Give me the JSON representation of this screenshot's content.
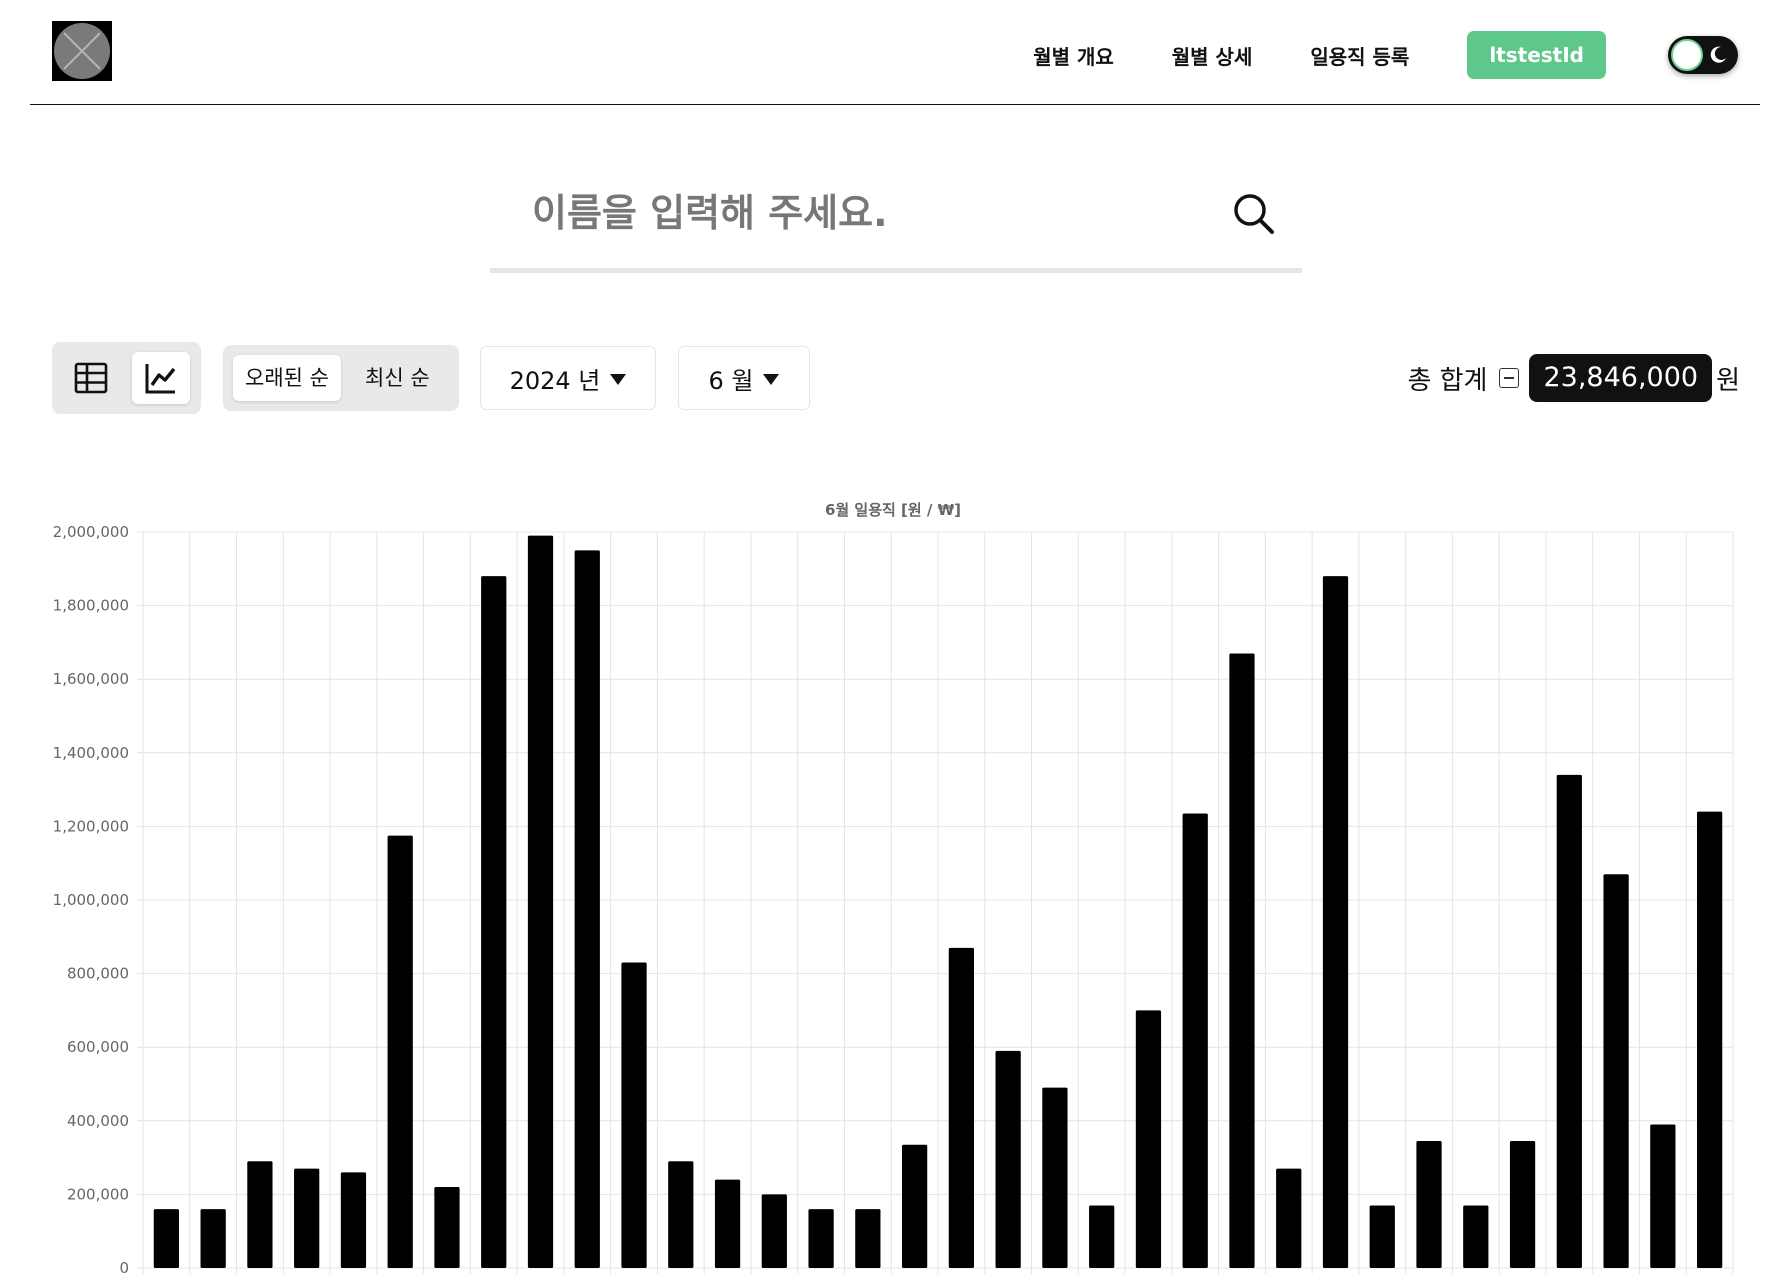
{
  "header": {
    "nav": [
      "월별 개요",
      "월별 상세",
      "일용직 등록"
    ],
    "user": "ltstestId"
  },
  "search": {
    "placeholder": "이름을 입력해 주세요."
  },
  "controls": {
    "view_active": "chart",
    "sort_options": [
      "오래된 순",
      "최신 순"
    ],
    "sort_active": "오래된 순",
    "year": "2024 년",
    "month": "6 월"
  },
  "total": {
    "label": "총 합계",
    "amount": "23,846,000",
    "unit": "원"
  },
  "colors": {
    "accent": "#5ec88a",
    "bar": "#000000",
    "grid": "#e4e4e4"
  },
  "chart_data": {
    "type": "bar",
    "title": "6월 일용직 [원 / ₩]",
    "xlabel": "",
    "ylabel": "",
    "ylim": [
      0,
      2000000
    ],
    "yticks": [
      0,
      200000,
      400000,
      600000,
      800000,
      1000000,
      1200000,
      1400000,
      1600000,
      1800000,
      2000000
    ],
    "ytick_labels": [
      "0",
      "200,000",
      "400,000",
      "600,000",
      "800,000",
      "1,000,000",
      "1,200,000",
      "1,400,000",
      "1,600,000",
      "1,800,000",
      "2,000,000"
    ],
    "grid": true,
    "legend": "none",
    "values": [
      160000,
      160000,
      290000,
      270000,
      260000,
      1175000,
      220000,
      1880000,
      1990000,
      1950000,
      830000,
      290000,
      240000,
      200000,
      160000,
      160000,
      335000,
      870000,
      590000,
      490000,
      170000,
      700000,
      1235000,
      1670000,
      270000,
      1880000,
      170000,
      345000,
      170000,
      345000,
      1340000,
      1070000,
      390000,
      1240000
    ]
  }
}
